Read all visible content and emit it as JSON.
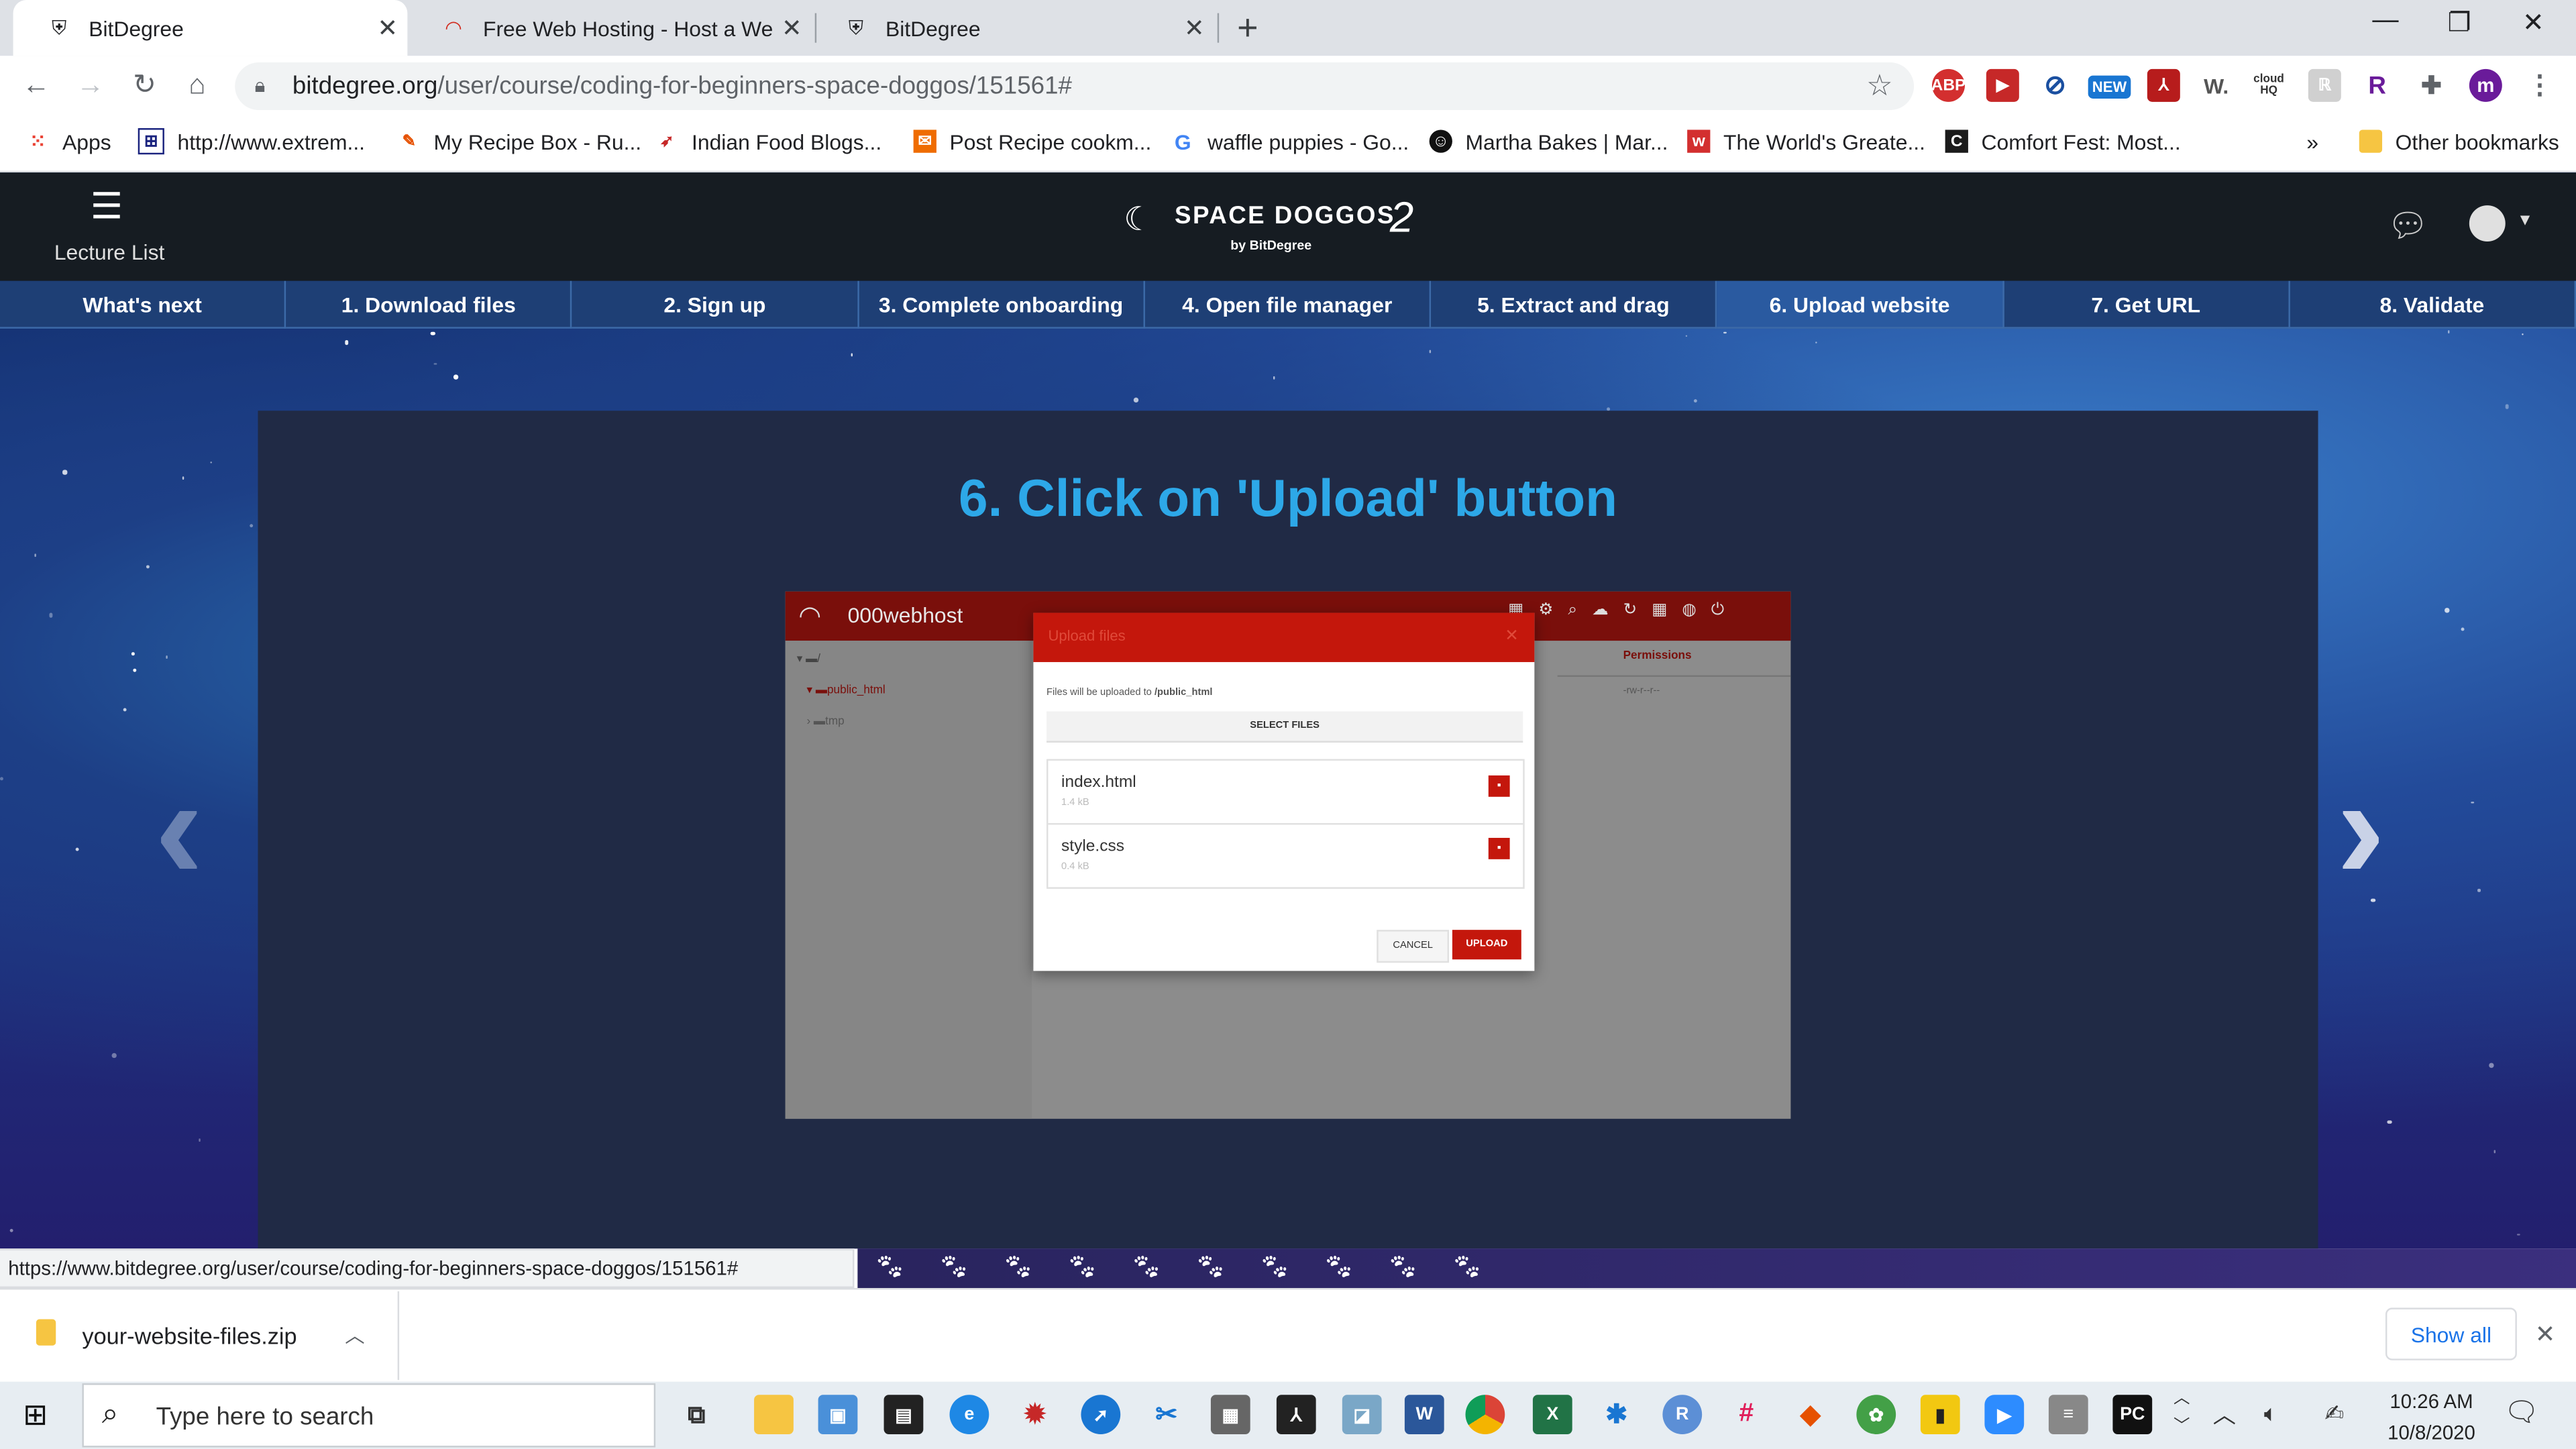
{
  "browser": {
    "tabs": [
      {
        "title": "BitDegree",
        "active": true
      },
      {
        "title": "Free Web Hosting - Host a Webs",
        "active": false
      },
      {
        "title": "BitDegree",
        "active": false
      }
    ],
    "new_tab": "+",
    "window_controls": {
      "minimize": "—",
      "maximize": "❐",
      "close": "✕"
    },
    "url_host": "bitdegree.org",
    "url_path": "/user/course/coding-for-beginners-space-doggos/151561#",
    "extensions": [
      "ABP",
      "NEW",
      "W.",
      "cloud HQ",
      "R",
      "m"
    ],
    "bookmarks": [
      "Apps",
      "http://www.extrem...",
      "My Recipe Box - Ru...",
      "Indian Food Blogs...",
      "Post Recipe cookm...",
      "waffle puppies - Go...",
      "Martha Bakes | Mar...",
      "The World's Greate...",
      "Comfort Fest: Most...",
      "»",
      "Other bookmarks"
    ]
  },
  "site": {
    "menu_label": "Lecture List",
    "logo_title": "SPACE DOGGOS",
    "logo_number": "2",
    "logo_sub": "by BitDegree",
    "steps": [
      "What's next",
      "1. Download files",
      "2. Sign up",
      "3. Complete onboarding",
      "4. Open file manager",
      "5. Extract and drag",
      "6. Upload website",
      "7. Get URL",
      "8. Validate"
    ],
    "active_step": 6,
    "heading": "6. Click on 'Upload' button"
  },
  "screenshot": {
    "brand": "000webhost",
    "tree_root": "/",
    "tree_items": [
      "public_html",
      "tmp"
    ],
    "col_header": "Permissions",
    "perm_value": "-rw-r--r--",
    "modal_title": "Upload files",
    "modal_note_prefix": "Files will be uploaded to ",
    "modal_note_path": "/public_html",
    "select_label": "SELECT FILES",
    "files": [
      {
        "name": "index.html",
        "size": "1.4 kB"
      },
      {
        "name": "style.css",
        "size": "0.4 kB"
      }
    ],
    "cancel_label": "CANCEL",
    "upload_label": "UPLOAD"
  },
  "status_url": "https://www.bitdegree.org/user/course/coding-for-beginners-space-doggos/151561#",
  "download": {
    "file": "your-website-files.zip",
    "show_all": "Show all"
  },
  "taskbar": {
    "search_placeholder": "Type here to search",
    "time": "10:26 AM",
    "date": "10/8/2020"
  },
  "colors": {
    "accent": "#2da8e8",
    "host_red": "#c4170c",
    "nav_bg": "#161c22"
  }
}
